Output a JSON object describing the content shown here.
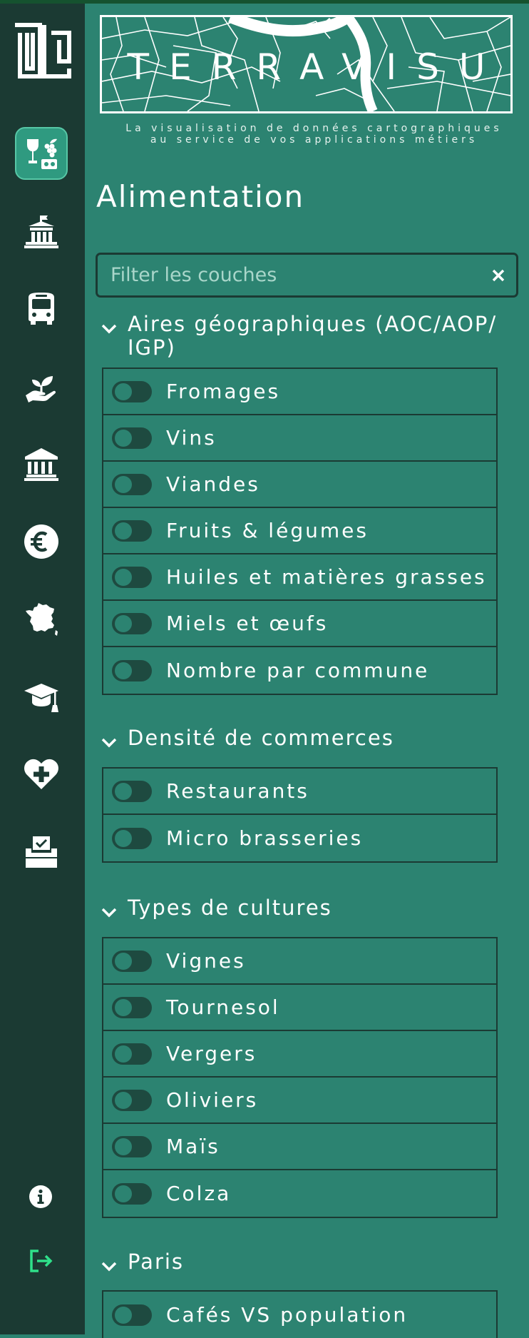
{
  "branding": {
    "name": "TERRAVISU",
    "tagline_line1": "La visualisation de données cartographiques",
    "tagline_line2": "au service de vos applications métiers"
  },
  "sidebar": {
    "items": [
      {
        "icon": "wine-food-icon",
        "active": true
      },
      {
        "icon": "town-hall-icon",
        "active": false
      },
      {
        "icon": "bus-icon",
        "active": false
      },
      {
        "icon": "hand-seedling-icon",
        "active": false
      },
      {
        "icon": "landmark-icon",
        "active": false
      },
      {
        "icon": "euro-icon",
        "active": false
      },
      {
        "icon": "france-map-icon",
        "active": false
      },
      {
        "icon": "graduation-cap-icon",
        "active": false
      },
      {
        "icon": "heart-plus-icon",
        "active": false
      },
      {
        "icon": "ballot-box-icon",
        "active": false
      }
    ],
    "info_icon": "info-icon",
    "logout_icon": "logout-icon"
  },
  "main": {
    "title": "Alimentation",
    "search": {
      "placeholder": "Filter les couches",
      "value": ""
    },
    "groups": [
      {
        "title": "Aires géographiques (AOC/AOP/IGP)",
        "title_line1": "Aires géographiques (AOC/AOP/",
        "title_line2": "IGP)",
        "layers": [
          "Fromages",
          "Vins",
          "Viandes",
          "Fruits & légumes",
          "Huiles et matières grasses",
          "Miels et œufs",
          "Nombre par commune"
        ]
      },
      {
        "title": "Densité de commerces",
        "layers": [
          "Restaurants",
          "Micro brasseries"
        ]
      },
      {
        "title": "Types de cultures",
        "layers": [
          "Vignes",
          "Tournesol",
          "Vergers",
          "Oliviers",
          "Maïs",
          "Colza"
        ]
      },
      {
        "title": "Paris",
        "layers": [
          "Cafés VS population"
        ]
      }
    ]
  },
  "colors": {
    "panel": "#2c8371",
    "sidebar": "#1b3a33",
    "active_item": "#2f9a80",
    "accent_exit": "#2fe08a"
  }
}
